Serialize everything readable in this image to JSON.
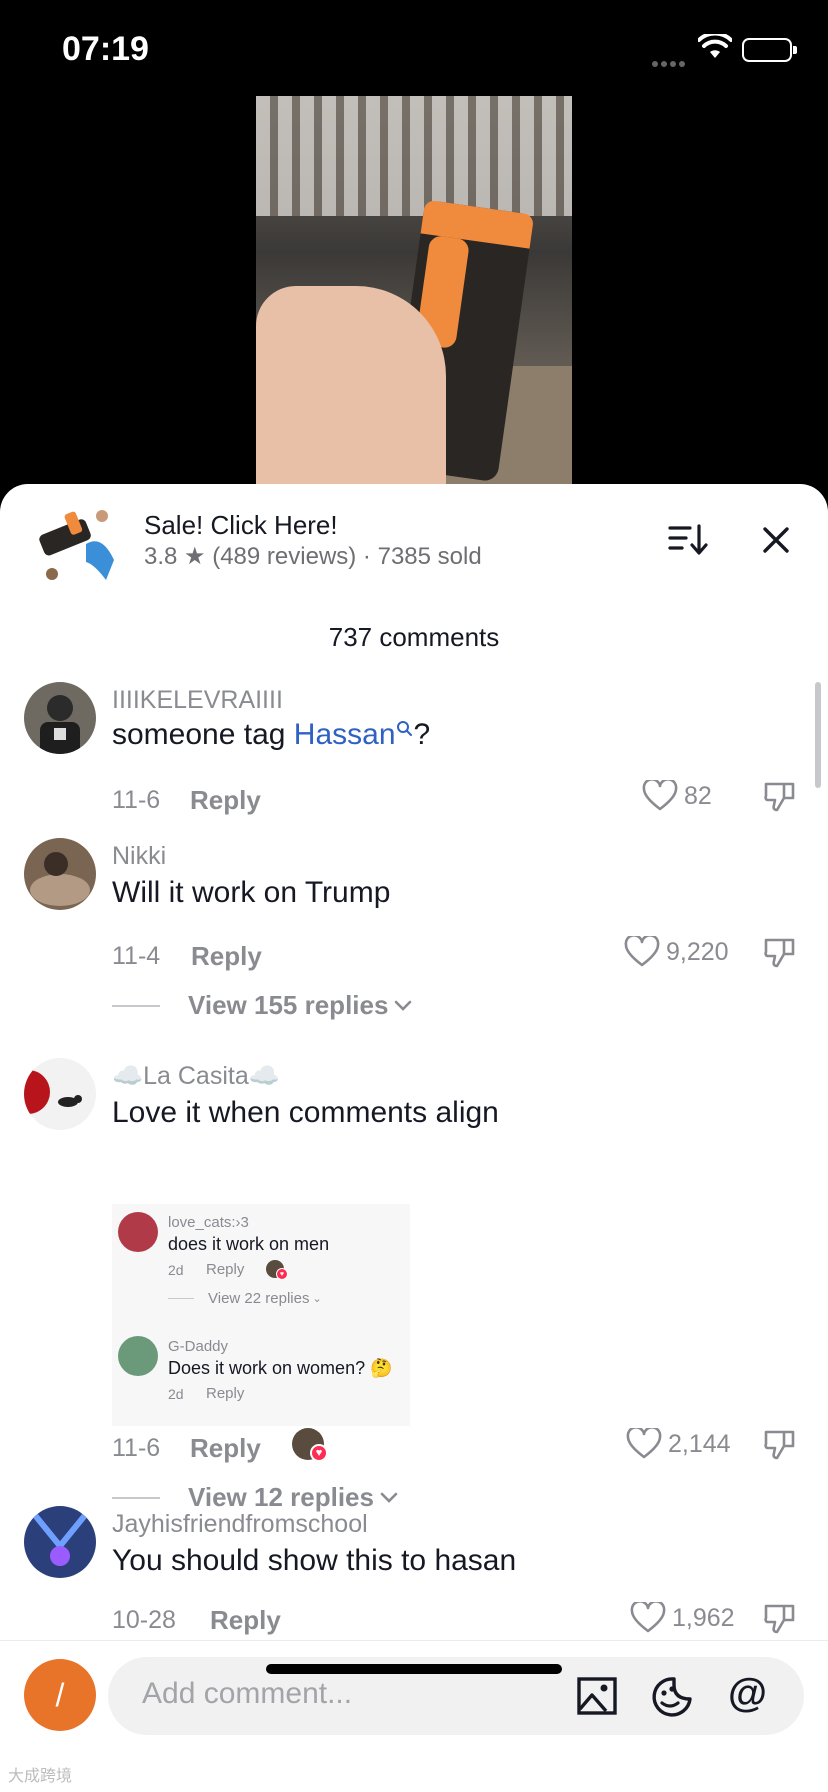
{
  "status_bar": {
    "time": "07:19"
  },
  "product": {
    "title": "Sale! Click Here!",
    "meta": "3.8 ★ (489 reviews) · 7385 sold"
  },
  "comments_count": "737 comments",
  "comments": [
    {
      "username": "IIIIKELEVRAIIII",
      "text_before": "someone tag ",
      "tag": "Hassan",
      "text_after": "?",
      "date": "11-6",
      "reply": "Reply",
      "likes": "82"
    },
    {
      "username": "Nikki",
      "text": "Will it work on Trump",
      "date": "11-4",
      "reply": "Reply",
      "likes": "9,220",
      "view_replies": "View 155 replies"
    },
    {
      "username": "☁️La Casita☁️",
      "text": "Love it when comments align",
      "date": "11-6",
      "reply": "Reply",
      "likes": "2,144",
      "view_replies": "View 12 replies",
      "embedded": [
        {
          "username": "love_cats:›3",
          "text": "does it work on men",
          "date": "2d",
          "reply": "Reply",
          "view_replies": "View 22 replies"
        },
        {
          "username": "G-Daddy",
          "text": "Does it work on women? 🤔",
          "date": "2d",
          "reply": "Reply"
        }
      ]
    },
    {
      "username": "Jayhisfriendfromschool",
      "text": "You should show this to hasan",
      "date": "10-28",
      "reply": "Reply",
      "likes": "1,962"
    }
  ],
  "composer": {
    "avatar_letter": "/",
    "placeholder": "Add comment...",
    "at": "@"
  },
  "watermark": "大成跨境",
  "colors": {
    "accent_tag": "#2f61c4",
    "like_heart_badge": "#fe2c55",
    "self_avatar": "#e8742a"
  }
}
